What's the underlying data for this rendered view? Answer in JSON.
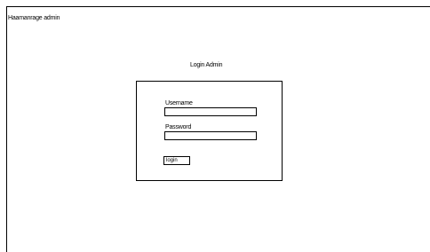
{
  "header": {
    "app_title": "Haamanrage admin"
  },
  "login": {
    "heading": "Login Admin",
    "username_label": "Username",
    "username_value": "",
    "password_label": "Password",
    "password_value": "",
    "button_label": "login"
  }
}
